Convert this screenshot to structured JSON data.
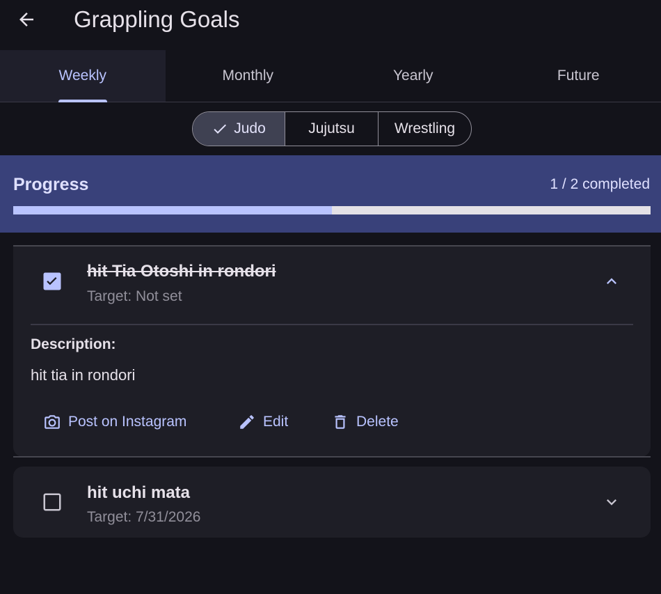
{
  "header": {
    "title": "Grappling Goals",
    "back_icon": "arrow-left-icon"
  },
  "tabs": [
    {
      "label": "Weekly",
      "active": true
    },
    {
      "label": "Monthly",
      "active": false
    },
    {
      "label": "Yearly",
      "active": false
    },
    {
      "label": "Future",
      "active": false
    }
  ],
  "segments": [
    {
      "label": "Judo",
      "selected": true
    },
    {
      "label": "Jujutsu",
      "selected": false
    },
    {
      "label": "Wrestling",
      "selected": false
    }
  ],
  "progress": {
    "title": "Progress",
    "count_text": "1 / 2 completed",
    "fraction": 0.5
  },
  "goals": [
    {
      "title": "hit Tia Otoshi in rondori",
      "target": "Target: Not set",
      "completed": true,
      "expanded": true,
      "description_label": "Description:",
      "description": "hit tia in rondori",
      "actions": {
        "instagram": "Post on Instagram",
        "edit": "Edit",
        "delete": "Delete"
      }
    },
    {
      "title": "hit uchi mata",
      "target": "Target: 7/31/2026",
      "completed": false,
      "expanded": false
    }
  ],
  "colors": {
    "background": "#13131a",
    "accent": "#b9c3ff",
    "progress_card": "#39417a",
    "card": "#1e1e26"
  }
}
